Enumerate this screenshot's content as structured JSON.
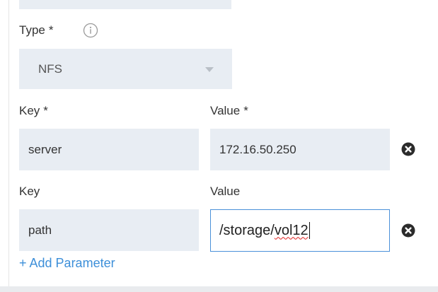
{
  "form": {
    "type": {
      "label": "Type",
      "required_marker": "*",
      "info_icon": "info-circle-icon",
      "selected_value": "NFS",
      "caret_icon": "caret-down-icon"
    },
    "parameters": [
      {
        "key_label": "Key",
        "key_required_marker": "*",
        "value_label": "Value",
        "value_required_marker": "*",
        "key": "server",
        "value": "172.16.50.250",
        "remove_icon": "remove-circle-icon"
      },
      {
        "key_label": "Key",
        "value_label": "Value",
        "key": "path",
        "value_prefix": "/storage/",
        "value_misspelled": "vol12",
        "remove_icon": "remove-circle-icon"
      }
    ],
    "add_parameter_label": "+ Add Parameter"
  },
  "colors": {
    "field_bg": "#e8edf3",
    "link": "#3d8fd9",
    "focus_border": "#4a90d9",
    "text": "#333333",
    "remove_icon": "#2b2b2b"
  }
}
